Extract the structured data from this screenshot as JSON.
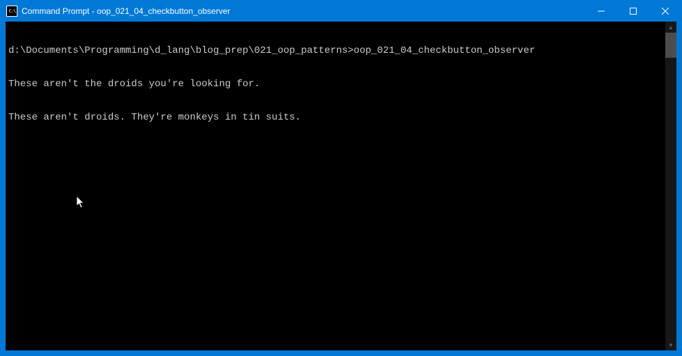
{
  "titlebar": {
    "icon_label": "C:\\",
    "title": "Command Prompt - oop_021_04_checkbutton_observer",
    "minimize": "–",
    "maximize": "☐",
    "close": "✕"
  },
  "terminal": {
    "lines": [
      "d:\\Documents\\Programming\\d_lang\\blog_prep\\021_oop_patterns>oop_021_04_checkbutton_observer",
      "These aren't the droids you're looking for.",
      "These aren't droids. They're monkeys in tin suits."
    ]
  },
  "scrollbar": {
    "up": "▲",
    "down": "▼"
  }
}
